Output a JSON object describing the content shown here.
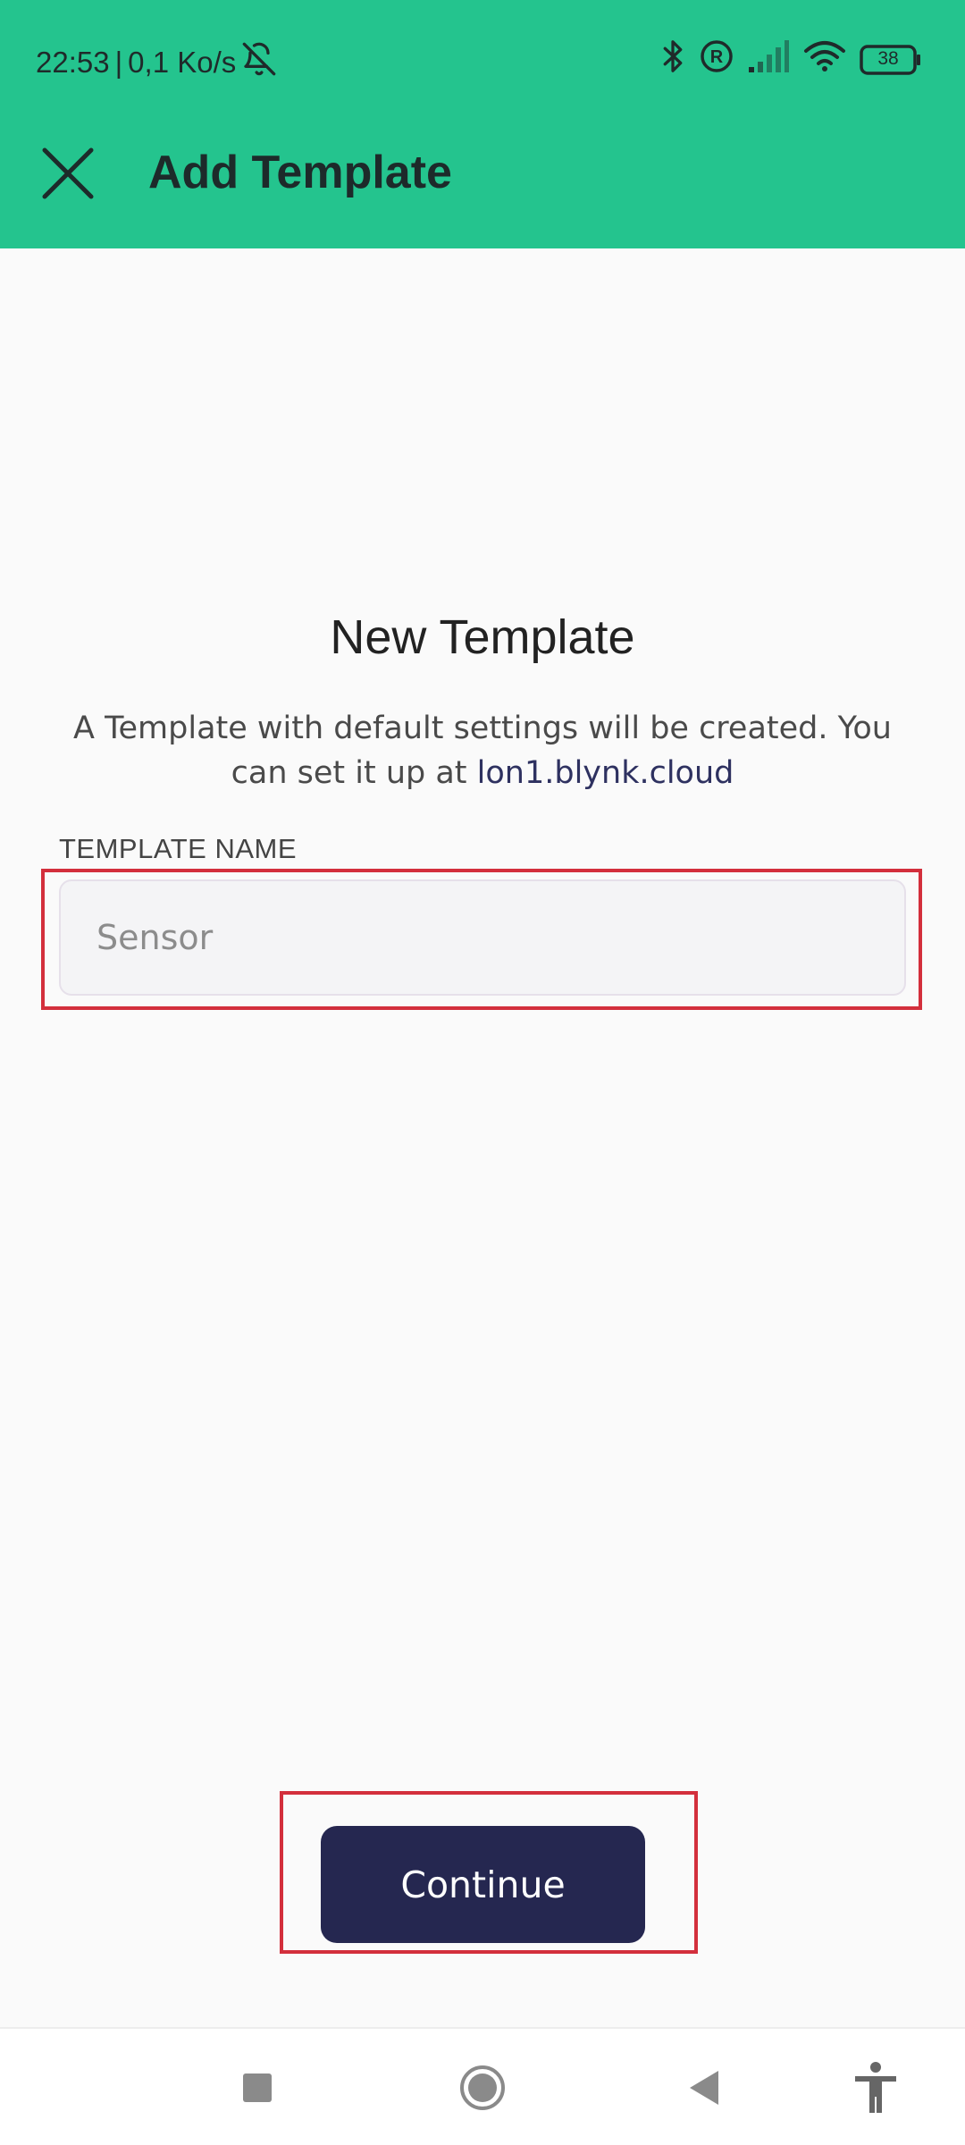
{
  "status_bar": {
    "time": "22:53",
    "separator": "|",
    "network_speed": "0,1 Ko/s",
    "battery_level": "38",
    "icons": [
      "notifications-muted-icon",
      "bluetooth-icon",
      "registered-icon",
      "signal-icon",
      "wifi-icon",
      "battery-icon"
    ]
  },
  "app_bar": {
    "title": "Add Template",
    "close_icon": "close-icon"
  },
  "content": {
    "heading": "New Template",
    "description_prefix": "A Template with default settings will be created. You can set it up at ",
    "description_link": "lon1.blynk.cloud",
    "field_label": "TEMPLATE NAME",
    "field_value": "",
    "field_placeholder": "Sensor"
  },
  "actions": {
    "continue_label": "Continue"
  },
  "nav_bar": {
    "icons": [
      "recents-icon",
      "home-icon",
      "back-icon",
      "accessibility-icon"
    ]
  },
  "colors": {
    "header": "#24C48E",
    "background": "#FAFAFA",
    "primary_button": "#252750",
    "highlight": "#D32F3C"
  }
}
